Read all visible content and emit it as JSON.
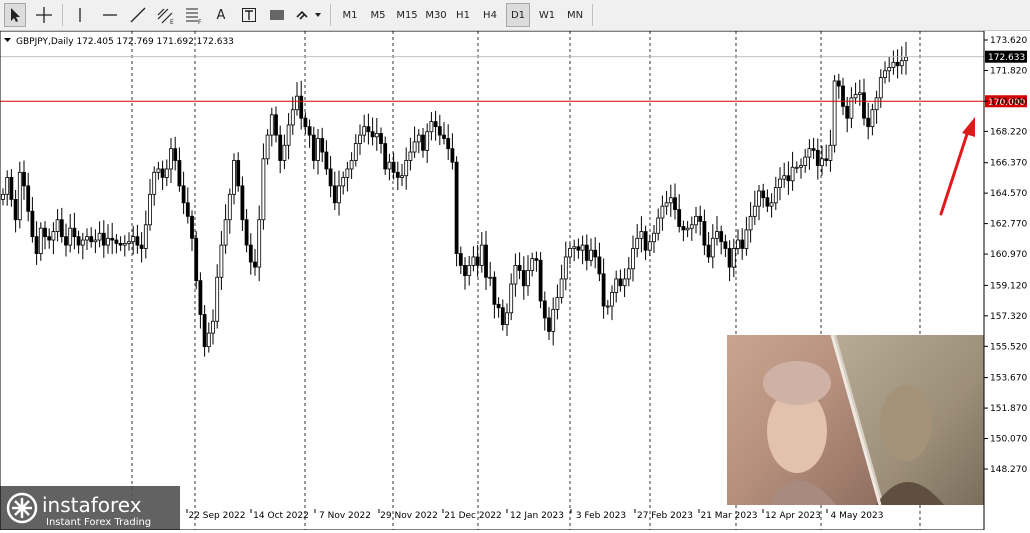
{
  "toolbar": {
    "tools": [
      {
        "name": "cursor-icon"
      },
      {
        "name": "crosshair-icon"
      },
      {
        "name": "vertical-line-icon"
      },
      {
        "name": "horizontal-line-icon"
      },
      {
        "name": "trendline-icon"
      },
      {
        "name": "equidistant-channel-icon"
      },
      {
        "name": "fibonacci-icon"
      },
      {
        "name": "text-icon",
        "label": "A"
      },
      {
        "name": "text-label-icon"
      },
      {
        "name": "rectangle-icon"
      },
      {
        "name": "arrows-dropdown-icon"
      }
    ],
    "timeframes": [
      "M1",
      "M5",
      "M15",
      "M30",
      "H1",
      "H4",
      "D1",
      "W1",
      "MN"
    ],
    "active_timeframe": "D1"
  },
  "chart_header": "GBPJPY,Daily  172.405 172.769 171.692 172.633",
  "watermark": {
    "brand": "instaforex",
    "tagline": "Instant Forex Trading"
  },
  "chart_data": {
    "type": "candlestick",
    "symbol": "GBPJPY",
    "timeframe": "Daily",
    "ohlc_last": {
      "open": 172.405,
      "high": 172.769,
      "low": 171.692,
      "close": 172.633
    },
    "y_ticks": [
      173.62,
      171.82,
      170.0,
      168.22,
      166.37,
      164.57,
      162.77,
      160.97,
      159.12,
      157.32,
      155.52,
      153.67,
      151.87,
      150.07,
      148.27
    ],
    "y_tick_labels": [
      "173.620",
      "171.820",
      "170.000",
      "168.220",
      "166.370",
      "164.570",
      "162.770",
      "160.970",
      "159.120",
      "157.320",
      "155.520",
      "153.670",
      "151.870",
      "150.070",
      "148.270"
    ],
    "ylim": [
      147.9,
      174.3
    ],
    "x_labels": [
      "22 Sep 2022",
      "14 Oct 2022",
      "7 Nov 2022",
      "29 Nov 2022",
      "21 Dec 2022",
      "12 Jan 2023",
      "3 Feb 2023",
      "27 Feb 2023",
      "21 Mar 2023",
      "12 Apr 2023",
      "4 May 2023"
    ],
    "current_price": 172.633,
    "current_price_label": "172.633",
    "level_line": {
      "value": 170.0,
      "label": "170.000",
      "color": "#d40000"
    },
    "arrow": {
      "color": "#e0191b",
      "direction": "up-right"
    },
    "candle_up_color": "#000000",
    "candle_down_color": "#000000",
    "grid": "dashed vertical",
    "closes": [
      164.5,
      165.5,
      164.2,
      163.0,
      165.8,
      165.0,
      163.5,
      162.0,
      161.0,
      162.5,
      162.0,
      161.8,
      162.3,
      163.0,
      162.0,
      161.5,
      162.5,
      162.0,
      161.5,
      161.8,
      162.0,
      161.7,
      161.8,
      162.2,
      161.5,
      161.9,
      161.8,
      161.6,
      161.5,
      161.6,
      161.7,
      162.0,
      161.5,
      161.3,
      162.7,
      164.5,
      165.8,
      166.0,
      165.5,
      166.0,
      167.2,
      166.5,
      165.0,
      164.0,
      163.2,
      161.9,
      159.4,
      157.4,
      155.5,
      156.3,
      157.0,
      159.6,
      161.5,
      163.0,
      164.5,
      166.5,
      165.0,
      163.0,
      161.5,
      160.5,
      160.2,
      163.0,
      166.6,
      168.0,
      169.2,
      168.0,
      166.5,
      167.4,
      168.6,
      169.5,
      170.3,
      169.0,
      168.5,
      168.0,
      166.5,
      167.8,
      167.0,
      166.0,
      165.0,
      164.0,
      165.0,
      165.5,
      166.0,
      166.5,
      167.5,
      168.0,
      168.5,
      168.2,
      167.9,
      168.1,
      167.5,
      166.0,
      166.4,
      165.8,
      165.5,
      165.6,
      166.5,
      167.0,
      167.6,
      168.0,
      167.1,
      168.2,
      168.8,
      168.5,
      168.0,
      167.8,
      167.2,
      166.4,
      161.0,
      160.3,
      159.7,
      160.3,
      160.8,
      160.3,
      161.5,
      159.6,
      159.6,
      158.0,
      157.8,
      156.8,
      157.5,
      159.2,
      160.3,
      160.0,
      159.1,
      160.0,
      160.7,
      160.6,
      158.2,
      157.2,
      156.4,
      157.7,
      158.4,
      159.5,
      160.8,
      161.3,
      161.4,
      161.2,
      161.5,
      160.6,
      161.2,
      160.8,
      159.8,
      157.9,
      157.9,
      158.7,
      159.5,
      159.1,
      159.5,
      160.1,
      161.3,
      161.9,
      162.3,
      161.2,
      161.7,
      162.2,
      163.1,
      163.8,
      164.0,
      164.3,
      163.6,
      162.6,
      162.4,
      162.5,
      162.7,
      163.2,
      162.9,
      161.5,
      160.8,
      161.9,
      162.3,
      161.7,
      161.3,
      160.2,
      161.3,
      161.8,
      161.3,
      162.4,
      163.2,
      163.8,
      164.7,
      164.3,
      163.8,
      164.0,
      164.9,
      165.4,
      165.6,
      165.3,
      166.1,
      166.1,
      166.2,
      166.7,
      167.2,
      167.1,
      166.2,
      166.6,
      166.5,
      167.4,
      171.2,
      170.9,
      169.7,
      169.0,
      170.2,
      170.4,
      170.5,
      169.0,
      168.5,
      169.5,
      170.2,
      171.4,
      171.8,
      172.0,
      172.3,
      172.1,
      172.4,
      172.6
    ]
  }
}
